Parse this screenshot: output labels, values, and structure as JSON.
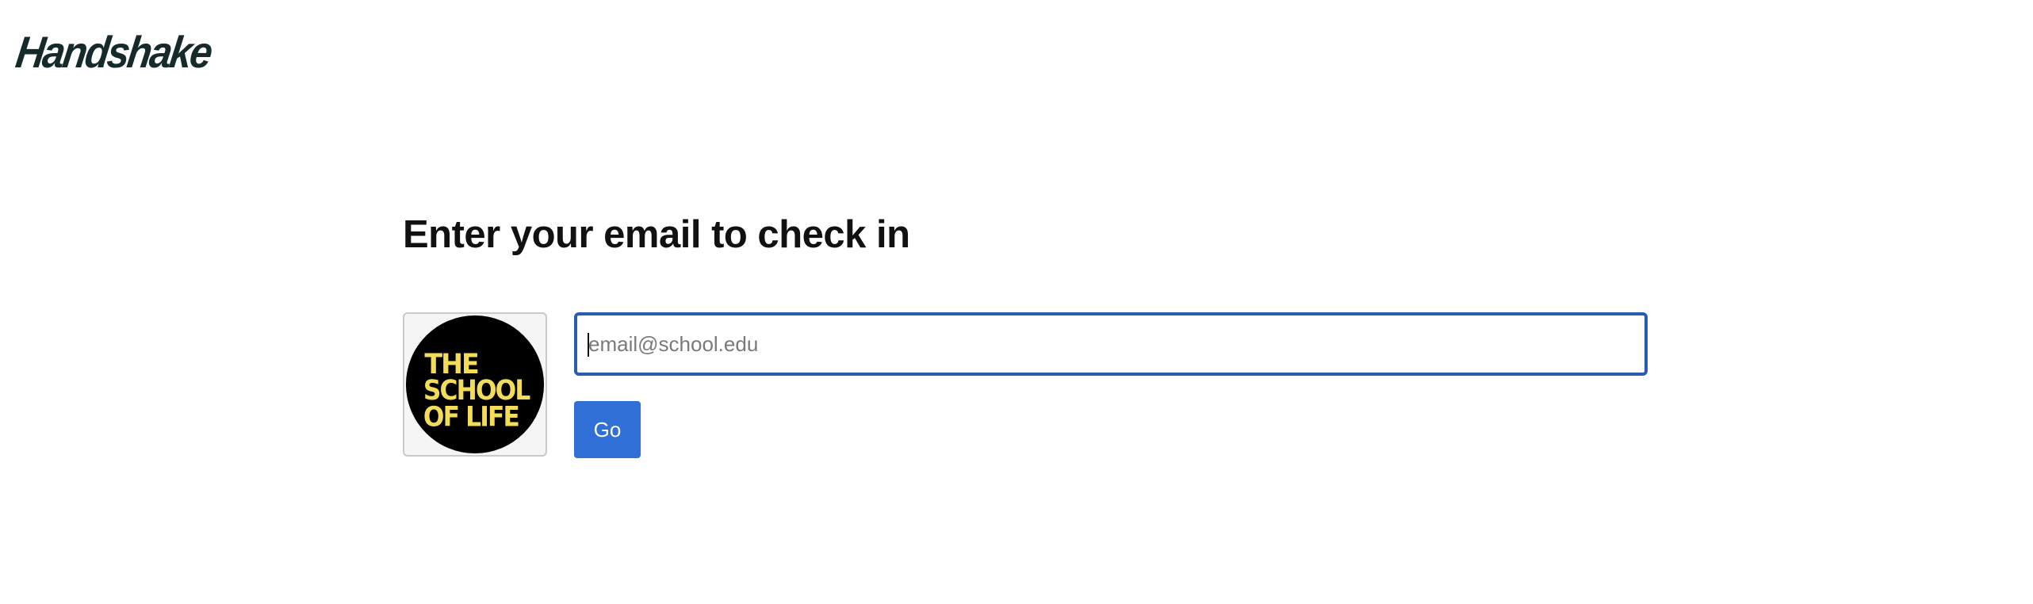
{
  "header": {
    "brand": "Handshake"
  },
  "checkin": {
    "heading": "Enter your email to check in",
    "email_placeholder": "email@school.edu",
    "email_value": "",
    "go_label": "Go"
  },
  "organizer_logo": {
    "lines": [
      "THE",
      "SCHOOL",
      "OF LIFE"
    ],
    "circle_color": "#000000",
    "text_color": "#f2dc5a"
  },
  "colors": {
    "brand_text": "#162a2b",
    "input_focus_border": "#2a5db0",
    "button_bg": "#2f6fd6"
  }
}
